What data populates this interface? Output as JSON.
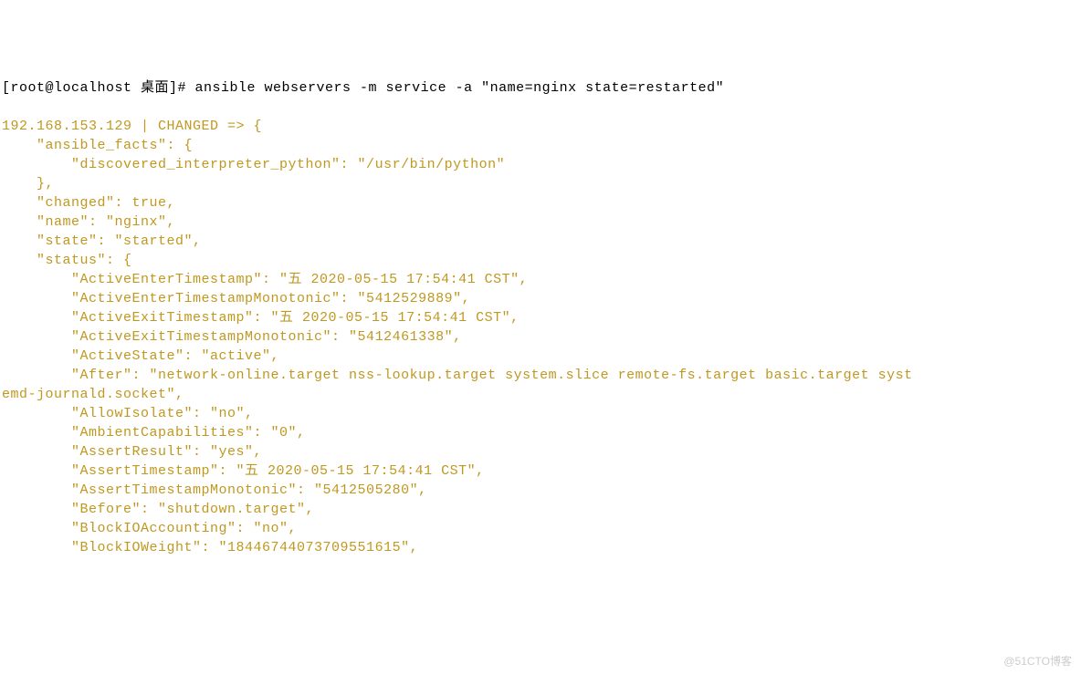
{
  "prompt_line": "[root@localhost 桌面]# ansible webservers -m service -a \"name=nginx state=restarted\"",
  "output_lines": [
    "192.168.153.129 | CHANGED => {",
    "    \"ansible_facts\": {",
    "        \"discovered_interpreter_python\": \"/usr/bin/python\"",
    "    },",
    "    \"changed\": true,",
    "    \"name\": \"nginx\",",
    "    \"state\": \"started\",",
    "    \"status\": {",
    "        \"ActiveEnterTimestamp\": \"五 2020-05-15 17:54:41 CST\",",
    "        \"ActiveEnterTimestampMonotonic\": \"5412529889\",",
    "        \"ActiveExitTimestamp\": \"五 2020-05-15 17:54:41 CST\",",
    "        \"ActiveExitTimestampMonotonic\": \"5412461338\",",
    "        \"ActiveState\": \"active\",",
    "        \"After\": \"network-online.target nss-lookup.target system.slice remote-fs.target basic.target syst",
    "emd-journald.socket\",",
    "        \"AllowIsolate\": \"no\",",
    "        \"AmbientCapabilities\": \"0\",",
    "        \"AssertResult\": \"yes\",",
    "        \"AssertTimestamp\": \"五 2020-05-15 17:54:41 CST\",",
    "        \"AssertTimestampMonotonic\": \"5412505280\",",
    "        \"Before\": \"shutdown.target\",",
    "        \"BlockIOAccounting\": \"no\",",
    "        \"BlockIOWeight\": \"18446744073709551615\","
  ],
  "watermark": "@51CTO博客"
}
